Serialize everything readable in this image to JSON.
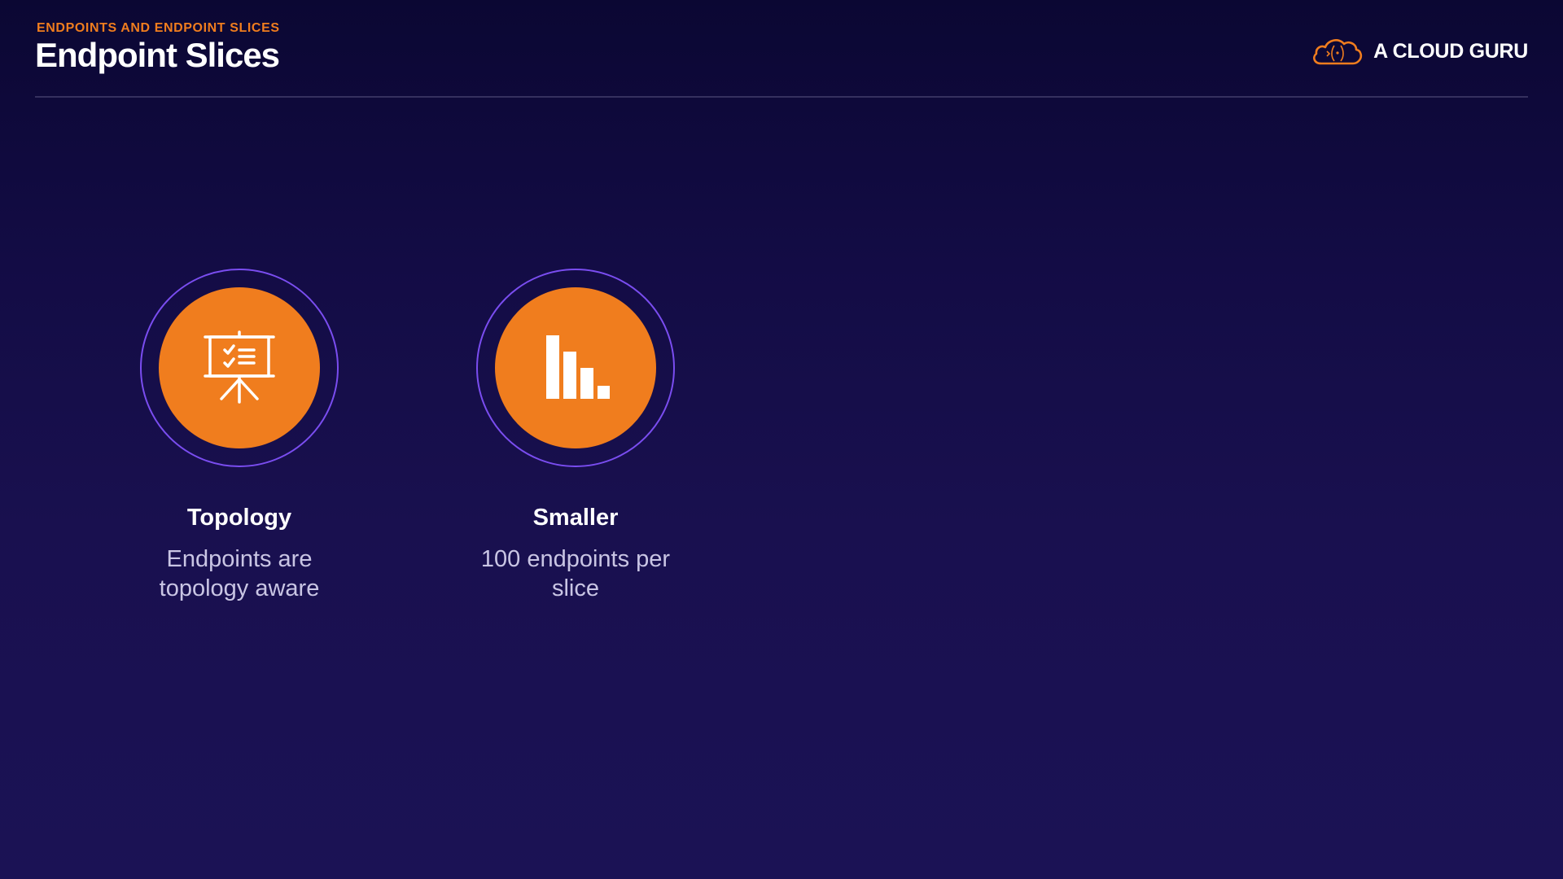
{
  "header": {
    "eyebrow": "ENDPOINTS AND ENDPOINT SLICES",
    "title": "Endpoint Slices"
  },
  "brand": {
    "name": "A CLOUD GURU",
    "logo_icon": "cloud-logo-icon"
  },
  "features": [
    {
      "icon": "presentation-board-checklist-icon",
      "title": "Topology",
      "description_line1": "Endpoints are",
      "description_line2": "topology aware"
    },
    {
      "icon": "descending-bar-chart-icon",
      "title": "Smaller",
      "description_line1": "100 endpoints per",
      "description_line2": "slice"
    }
  ],
  "colors": {
    "accent": "#f07d1e",
    "ring": "#7a4df0",
    "background_top": "#0b0733",
    "background_bottom": "#1b1255",
    "description_text": "#c9c5e4"
  }
}
